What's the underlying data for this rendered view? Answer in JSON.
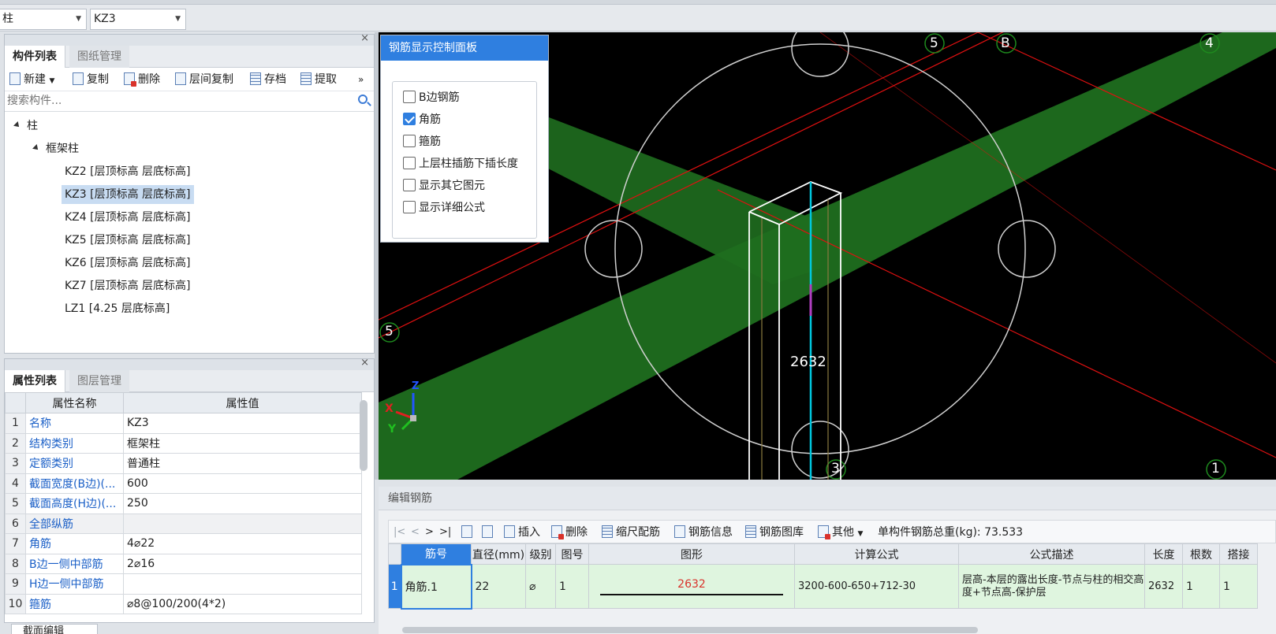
{
  "topbar": {
    "floor_value": "柱",
    "component_value": "KZ3"
  },
  "component_panel": {
    "tabs": [
      "构件列表",
      "图纸管理"
    ],
    "toolbar": [
      "新建",
      "复制",
      "删除",
      "层间复制",
      "存档",
      "提取"
    ],
    "more_glyph": "»",
    "search_placeholder": "搜索构件...",
    "tree": {
      "root": "柱",
      "group": "框架柱",
      "items": [
        "KZ2 [层顶标高 层底标高]",
        "KZ3 [层顶标高 层底标高]",
        "KZ4 [层顶标高 层底标高]",
        "KZ5 [层顶标高 层底标高]",
        "KZ6 [层顶标高 层底标高]",
        "KZ7 [层顶标高 层底标高]",
        "LZ1 [4.25 层底标高]"
      ],
      "selected_index": 1
    }
  },
  "property_panel": {
    "tabs": [
      "属性列表",
      "图层管理"
    ],
    "headers": [
      "属性名称",
      "属性值"
    ],
    "rows": [
      {
        "n": "1",
        "name": "名称",
        "value": "KZ3"
      },
      {
        "n": "2",
        "name": "结构类别",
        "value": "框架柱"
      },
      {
        "n": "3",
        "name": "定额类别",
        "value": "普通柱"
      },
      {
        "n": "4",
        "name": "截面宽度(B边)(...",
        "value": "600"
      },
      {
        "n": "5",
        "name": "截面高度(H边)(...",
        "value": "250"
      },
      {
        "n": "6",
        "name": "全部纵筋",
        "value": ""
      },
      {
        "n": "7",
        "name": "角筋",
        "value": "4⌀22"
      },
      {
        "n": "8",
        "name": "B边一侧中部筋",
        "value": "2⌀16"
      },
      {
        "n": "9",
        "name": "H边一侧中部筋",
        "value": ""
      },
      {
        "n": "10",
        "name": "箍筋",
        "value": "⌀8@100/200(4*2)"
      }
    ],
    "bottom_tab": "截面编辑"
  },
  "control_panel": {
    "title": "钢筋显示控制面板",
    "options": [
      {
        "label": "B边钢筋",
        "checked": false
      },
      {
        "label": "角筋",
        "checked": true
      },
      {
        "label": "箍筋",
        "checked": false
      },
      {
        "label": "上层柱插筋下插长度",
        "checked": false
      },
      {
        "label": "显示其它图元",
        "checked": false
      },
      {
        "label": "显示详细公式",
        "checked": false
      }
    ]
  },
  "viewport": {
    "axis_labels": {
      "x": "X",
      "y": "Y",
      "z": "Z"
    },
    "grid_markers": [
      "5",
      "B",
      "4",
      "5",
      "3",
      "1"
    ],
    "dimension_label": "2632",
    "colors": {
      "beam": "#1f7a1f",
      "grid_line": "#e01010",
      "rebar": "#00c8e0",
      "background": "#000000"
    }
  },
  "editor": {
    "title": "编辑钢筋",
    "nav": [
      "|<",
      "<",
      ">",
      ">|"
    ],
    "toolbar": [
      "插入",
      "删除",
      "缩尺配筋",
      "钢筋信息",
      "钢筋图库",
      "其他"
    ],
    "total_weight": "单构件钢筋总重(kg): 73.533",
    "headers": [
      "筋号",
      "直径(mm)",
      "级别",
      "图号",
      "图形",
      "计算公式",
      "公式描述",
      "长度",
      "根数",
      "搭接"
    ],
    "rows": [
      {
        "row_no": "1",
        "bar_no": "角筋.1",
        "diameter": "22",
        "grade": "⌀",
        "figure_no": "1",
        "shape_value": "2632",
        "formula": "3200-600-650+712-30",
        "description": "层高-本层的露出长度-节点与柱的相交高度+节点高-保护层",
        "length": "2632",
        "count": "1",
        "lap": "1"
      }
    ]
  }
}
